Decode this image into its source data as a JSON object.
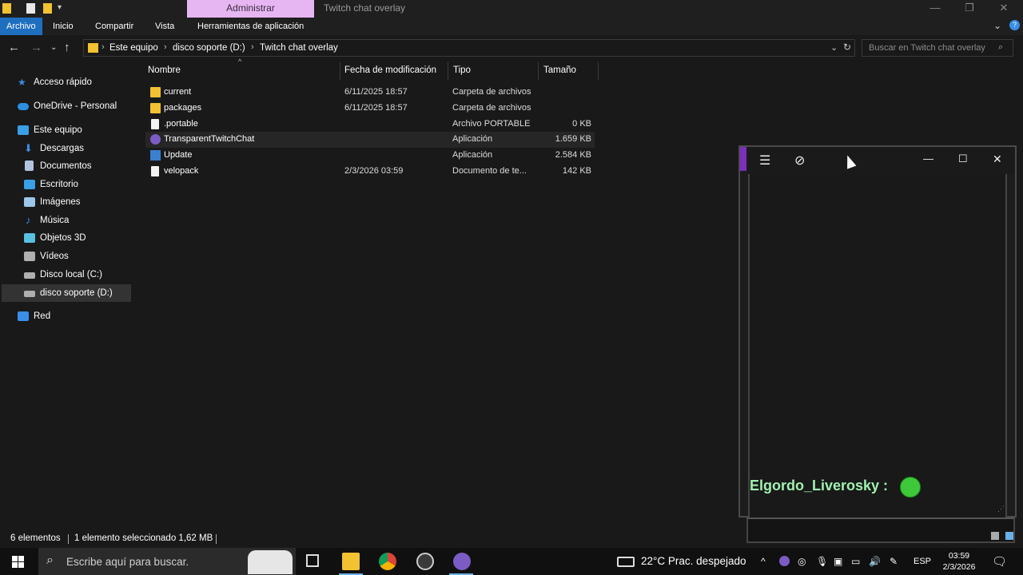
{
  "window": {
    "title": "Twitch chat overlay",
    "context_tab": "Administrar"
  },
  "ribbon": {
    "tabs": [
      "Archivo",
      "Inicio",
      "Compartir",
      "Vista",
      "Herramientas de aplicación"
    ]
  },
  "address": {
    "crumbs": [
      "Este equipo",
      "disco soporte (D:)",
      "Twitch chat overlay"
    ],
    "search_placeholder": "Buscar en Twitch chat overlay"
  },
  "sidebar": {
    "items": [
      {
        "label": "Acceso rápido",
        "icon": "star-icon",
        "color": "#3a8ee6"
      },
      {
        "label": "OneDrive - Personal",
        "icon": "cloud-icon",
        "color": "#2a8fe0"
      },
      {
        "label": "Este equipo",
        "icon": "computer-icon",
        "color": "#3aa0e6"
      },
      {
        "label": "Descargas",
        "icon": "download-icon",
        "color": "#3a8ee6"
      },
      {
        "label": "Documentos",
        "icon": "documents-icon",
        "color": "#b0c4de"
      },
      {
        "label": "Escritorio",
        "icon": "desktop-icon",
        "color": "#3aa0e6"
      },
      {
        "label": "Imágenes",
        "icon": "pictures-icon",
        "color": "#9ec6e8"
      },
      {
        "label": "Música",
        "icon": "music-icon",
        "color": "#3a8ee6"
      },
      {
        "label": "Objetos 3D",
        "icon": "cube-icon",
        "color": "#5ac0e0"
      },
      {
        "label": "Vídeos",
        "icon": "video-icon",
        "color": "#b0b0b0"
      },
      {
        "label": "Disco local (C:)",
        "icon": "drive-icon",
        "color": "#b0b0b0"
      },
      {
        "label": "disco soporte (D:)",
        "icon": "drive-icon",
        "color": "#b0b0b0"
      },
      {
        "label": "Red",
        "icon": "network-icon",
        "color": "#3a8ee6"
      }
    ]
  },
  "columns": [
    "Nombre",
    "Fecha de modificación",
    "Tipo",
    "Tamaño"
  ],
  "files": [
    {
      "name": "current",
      "date": "6/11/2025 18:57",
      "type": "Carpeta de archivos",
      "size": "",
      "icon": "folder"
    },
    {
      "name": "packages",
      "date": "6/11/2025 18:57",
      "type": "Carpeta de archivos",
      "size": "",
      "icon": "folder"
    },
    {
      "name": ".portable",
      "date": "",
      "type": "Archivo PORTABLE",
      "size": "0 KB",
      "icon": "doc"
    },
    {
      "name": "TransparentTwitchChat",
      "date": "",
      "type": "Aplicación",
      "size": "1.659 KB",
      "icon": "app"
    },
    {
      "name": "Update",
      "date": "",
      "type": "Aplicación",
      "size": "2.584 KB",
      "icon": "exe"
    },
    {
      "name": "velopack",
      "date": "2/3/2026 03:59",
      "type": "Documento de te...",
      "size": "142 KB",
      "icon": "doc"
    }
  ],
  "status": {
    "count": "6 elementos",
    "selection": "1 elemento seleccionado  1,62 MB"
  },
  "overlay": {
    "chat_user": "Elgordo_Liverosky :",
    "accent": "#7b2fbe"
  },
  "taskbar": {
    "search_placeholder": "Escribe aquí para buscar.",
    "weather": "22°C  Prac. despejado",
    "language": "ESP",
    "time": "03:59",
    "date": "2/3/2026"
  }
}
